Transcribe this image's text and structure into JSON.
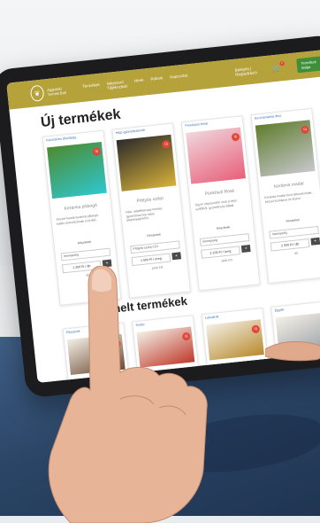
{
  "site": {
    "brand": "Aggteleki Termék Bolt",
    "menu": [
      "Termékek",
      "Népszerű Tájékoztató",
      "Hírek",
      "Rólunk",
      "Kapcsolat"
    ],
    "account": "Belépés | Regisztráció",
    "cart_count": "0",
    "cta": "Termékek listája"
  },
  "section_new": {
    "title": "Új termékek"
  },
  "section_featured": {
    "title": "Kiemelt termékek"
  },
  "products": [
    {
      "category": "Kézműves dísztárgy",
      "name": "Kerámia pillangó",
      "desc": "Kézzel festett kerámia pillangó, kültéri dekorációnak is kiváló.",
      "more": "Részletek",
      "qty_label": "mennyiség",
      "price": "1 200 Ft / db",
      "unit": "db",
      "img_colors": [
        "#4d8b2f",
        "#2fc7d0"
      ]
    },
    {
      "category": "Házi gyümölcslevek",
      "name": "Pöttyös szörp",
      "desc": "Házi, adalékanyag-mentes gyümölcsszörp natúr alapanyagokból.",
      "more": "Részletek",
      "qty_label": "Pöttyös szörp 0,5 l",
      "price": "1 600 Ft / üveg",
      "unit": "1000 Ft/l",
      "img_colors": [
        "#2a2a2a",
        "#d8b23a"
      ]
    },
    {
      "category": "Pincészet borai",
      "name": "Pünkösdi Rosé",
      "desc": "Egyre népszerűbb rosé a helyi szőlőből, gyümölcsös illattal.",
      "more": "Részletek",
      "qty_label": "mennyiség",
      "price": "2 100 Ft / üveg",
      "unit": "2800 Ft/l",
      "img_colors": [
        "#f0d6dc",
        "#e8607a"
      ]
    },
    {
      "category": "Kerti kerámia dísz",
      "name": "Kerámia madár",
      "desc": "Kerámia madár kerti dekorációnak, kézzel formázva és festve.",
      "more": "Részletek",
      "qty_label": "mennyiség",
      "price": "2 000 Ft / db",
      "unit": "db",
      "img_colors": [
        "#5f7d2e",
        "#c7c7cc"
      ]
    }
  ],
  "featured": [
    {
      "category": "Fűszerek"
    },
    {
      "category": "Szörp"
    },
    {
      "category": "Lekvárok"
    },
    {
      "category": "Egyéb"
    }
  ]
}
